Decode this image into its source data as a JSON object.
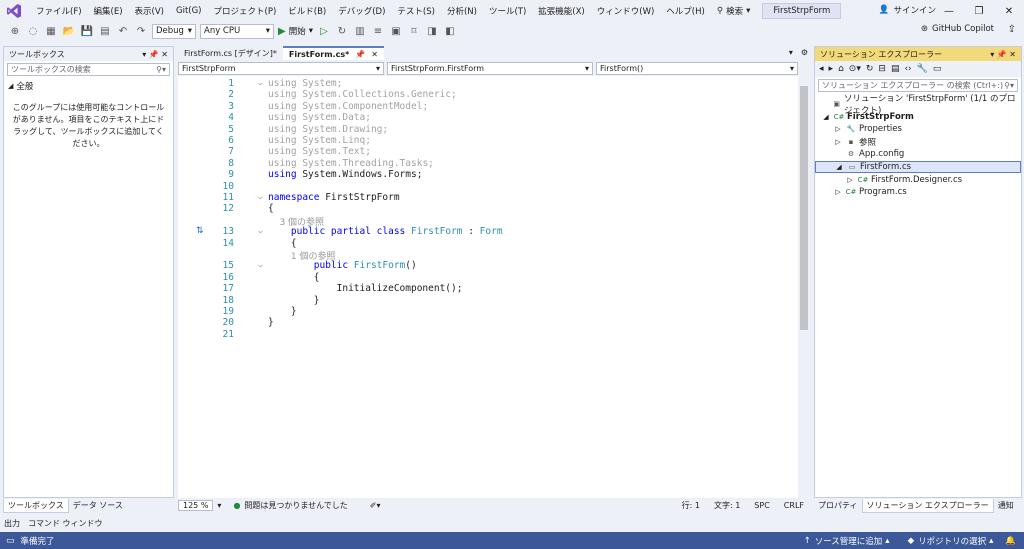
{
  "menu": {
    "items": [
      "ファイル(F)",
      "編集(E)",
      "表示(V)",
      "Git(G)",
      "プロジェクト(P)",
      "ビルド(B)",
      "デバッグ(D)",
      "テスト(S)",
      "分析(N)",
      "ツール(T)",
      "拡張機能(X)",
      "ウィンドウ(W)",
      "ヘルプ(H)"
    ],
    "search_label": "検索",
    "project_name": "FirstStrpForm",
    "signin": "サインイン"
  },
  "toolbar": {
    "config": "Debug",
    "platform": "Any CPU",
    "start_label": "開始",
    "copilot_label": "GitHub Copilot"
  },
  "toolbox": {
    "title": "ツールボックス",
    "search_placeholder": "ツールボックスの検索",
    "group_label": "全般",
    "empty_message": "このグループには使用可能なコントロールがありません。項目をこのテキスト上にドラッグして、ツールボックスに追加してください。",
    "tabs": [
      "ツールボックス",
      "データ ソース"
    ]
  },
  "editor": {
    "tabs": [
      {
        "label": "FirstForm.cs [デザイン]*"
      },
      {
        "label": "FirstForm.cs*"
      }
    ],
    "nav": [
      "FirstStrpForm",
      "FirstStrpForm.FirstForm",
      "FirstForm()"
    ],
    "lines": [
      {
        "n": "1",
        "parts": [
          {
            "t": "using",
            "c": "dim"
          },
          {
            "t": " System;",
            "c": "dim"
          }
        ]
      },
      {
        "n": "2",
        "parts": [
          {
            "t": "using",
            "c": "dim"
          },
          {
            "t": " System.Collections.Generic;",
            "c": "dim"
          }
        ]
      },
      {
        "n": "3",
        "parts": [
          {
            "t": "using",
            "c": "dim"
          },
          {
            "t": " System.ComponentModel;",
            "c": "dim"
          }
        ]
      },
      {
        "n": "4",
        "parts": [
          {
            "t": "using",
            "c": "dim"
          },
          {
            "t": " System.Data;",
            "c": "dim"
          }
        ]
      },
      {
        "n": "5",
        "parts": [
          {
            "t": "using",
            "c": "dim"
          },
          {
            "t": " System.Drawing;",
            "c": "dim"
          }
        ]
      },
      {
        "n": "6",
        "parts": [
          {
            "t": "using",
            "c": "dim"
          },
          {
            "t": " System.Linq;",
            "c": "dim"
          }
        ]
      },
      {
        "n": "7",
        "parts": [
          {
            "t": "using",
            "c": "dim"
          },
          {
            "t": " System.Text;",
            "c": "dim"
          }
        ]
      },
      {
        "n": "8",
        "parts": [
          {
            "t": "using",
            "c": "dim"
          },
          {
            "t": " System.Threading.Tasks;",
            "c": "dim"
          }
        ]
      },
      {
        "n": "9",
        "parts": [
          {
            "t": "using",
            "c": "kw"
          },
          {
            "t": " System.Windows.Forms;",
            "c": ""
          }
        ]
      },
      {
        "n": "10",
        "parts": []
      },
      {
        "n": "11",
        "parts": [
          {
            "t": "namespace",
            "c": "kw"
          },
          {
            "t": " FirstStrpForm",
            "c": ""
          }
        ]
      },
      {
        "n": "12",
        "parts": [
          {
            "t": "{",
            "c": ""
          }
        ]
      },
      {
        "n": "",
        "parts": [
          {
            "t": "    3 個の参照",
            "c": "ref"
          }
        ]
      },
      {
        "n": "13",
        "parts": [
          {
            "t": "    public partial class ",
            "c": "kw"
          },
          {
            "t": "FirstForm",
            "c": "ty"
          },
          {
            "t": " : ",
            "c": ""
          },
          {
            "t": "Form",
            "c": "ty"
          }
        ]
      },
      {
        "n": "14",
        "parts": [
          {
            "t": "    {",
            "c": ""
          }
        ]
      },
      {
        "n": "",
        "parts": [
          {
            "t": "        1 個の参照",
            "c": "ref"
          }
        ]
      },
      {
        "n": "15",
        "parts": [
          {
            "t": "        public ",
            "c": "kw"
          },
          {
            "t": "FirstForm",
            "c": "ty"
          },
          {
            "t": "()",
            "c": ""
          }
        ]
      },
      {
        "n": "16",
        "parts": [
          {
            "t": "        {",
            "c": ""
          }
        ]
      },
      {
        "n": "17",
        "parts": [
          {
            "t": "            InitializeComponent();",
            "c": ""
          }
        ]
      },
      {
        "n": "18",
        "parts": [
          {
            "t": "        }",
            "c": ""
          }
        ]
      },
      {
        "n": "19",
        "parts": [
          {
            "t": "    }",
            "c": ""
          }
        ]
      },
      {
        "n": "20",
        "parts": [
          {
            "t": "}",
            "c": ""
          }
        ]
      },
      {
        "n": "21",
        "parts": []
      }
    ],
    "zoom": "125 %",
    "issues": "問題は見つかりませんでした",
    "line": "行: 1",
    "col": "文字: 1",
    "spc": "SPC",
    "crlf": "CRLF"
  },
  "solution": {
    "title": "ソリューション エクスプローラー",
    "search_placeholder": "ソリューション エクスプローラー の検索 (Ctrl+:)",
    "items": [
      {
        "label": "ソリューション 'FirstStrpForm' (1/1 のプロジェクト)",
        "indent": 0,
        "icon": "solution-icon",
        "glyph": "▣",
        "arrow": ""
      },
      {
        "label": "FirstStrpForm",
        "indent": 0,
        "icon": "csharp-project-icon",
        "glyph": "C#",
        "arrow": "◢",
        "bold": true
      },
      {
        "label": "Properties",
        "indent": 1,
        "icon": "wrench-icon",
        "glyph": "🔧",
        "arrow": "▷"
      },
      {
        "label": "参照",
        "indent": 1,
        "icon": "references-icon",
        "glyph": "▪",
        "arrow": "▷"
      },
      {
        "label": "App.config",
        "indent": 1,
        "icon": "config-file-icon",
        "glyph": "⚙",
        "arrow": ""
      },
      {
        "label": "FirstForm.cs",
        "indent": 1,
        "icon": "form-icon",
        "glyph": "▭",
        "arrow": "◢",
        "selected": true
      },
      {
        "label": "FirstForm.Designer.cs",
        "indent": 2,
        "icon": "csharp-file-icon",
        "glyph": "C#",
        "arrow": "▷"
      },
      {
        "label": "Program.cs",
        "indent": 1,
        "icon": "csharp-file-icon",
        "glyph": "C#",
        "arrow": "▷"
      }
    ],
    "tabs": [
      "プロパティ",
      "ソリューション エクスプローラー",
      "通知"
    ]
  },
  "bottom_tabs": [
    "出力",
    "コマンド ウィンドウ"
  ],
  "status": {
    "ready": "準備完了",
    "source_control": "ソース管理に追加",
    "repo": "リポジトリの選択"
  }
}
